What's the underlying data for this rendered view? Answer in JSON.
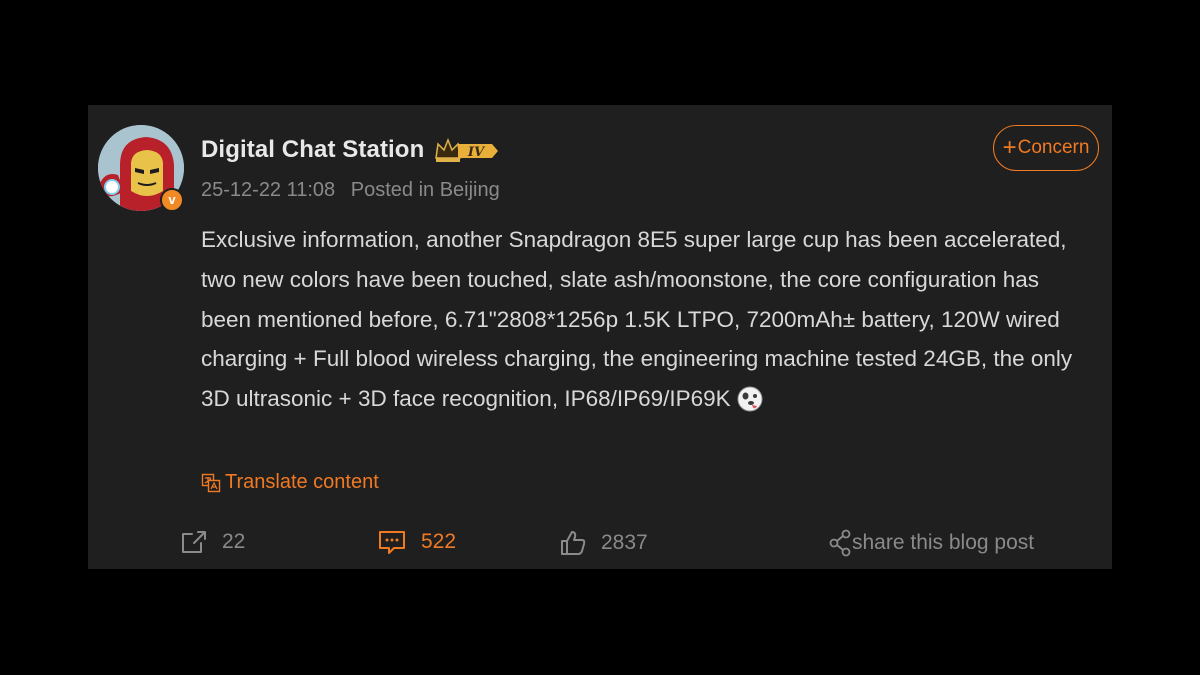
{
  "post": {
    "author": {
      "name": "Digital Chat Station",
      "level_badge": "IV",
      "verified_badge": "v",
      "avatar_icon": "iron-man-avatar"
    },
    "timestamp": "25-12-22 11:08",
    "location": "Posted in Beijing",
    "follow_label": "Concern",
    "follow_icon": "+",
    "body": "Exclusive information, another Snapdragon 8E5 super large cup has been accelerated, two new colors have been touched, slate ash/moonstone, the core configuration has been mentioned before, 6.71\"2808*1256p 1.5K LTPO, 7200mAh± battery, 120W wired charging + Full blood wireless charging, the engineering machine tested 24GB, the only 3D ultrasonic + 3D face recognition, IP68/IP69/IP69K",
    "body_emoji": "doge-tongue-emoji",
    "translate_label": "Translate content"
  },
  "actions": {
    "repost_count": "22",
    "comment_count": "522",
    "like_count": "2837",
    "share_label": "share this blog post"
  },
  "colors": {
    "background": "#000000",
    "card": "#1f1f1f",
    "accent": "#f07a24",
    "text_primary": "#e8e8e8",
    "text_secondary": "#8a8a8a"
  }
}
